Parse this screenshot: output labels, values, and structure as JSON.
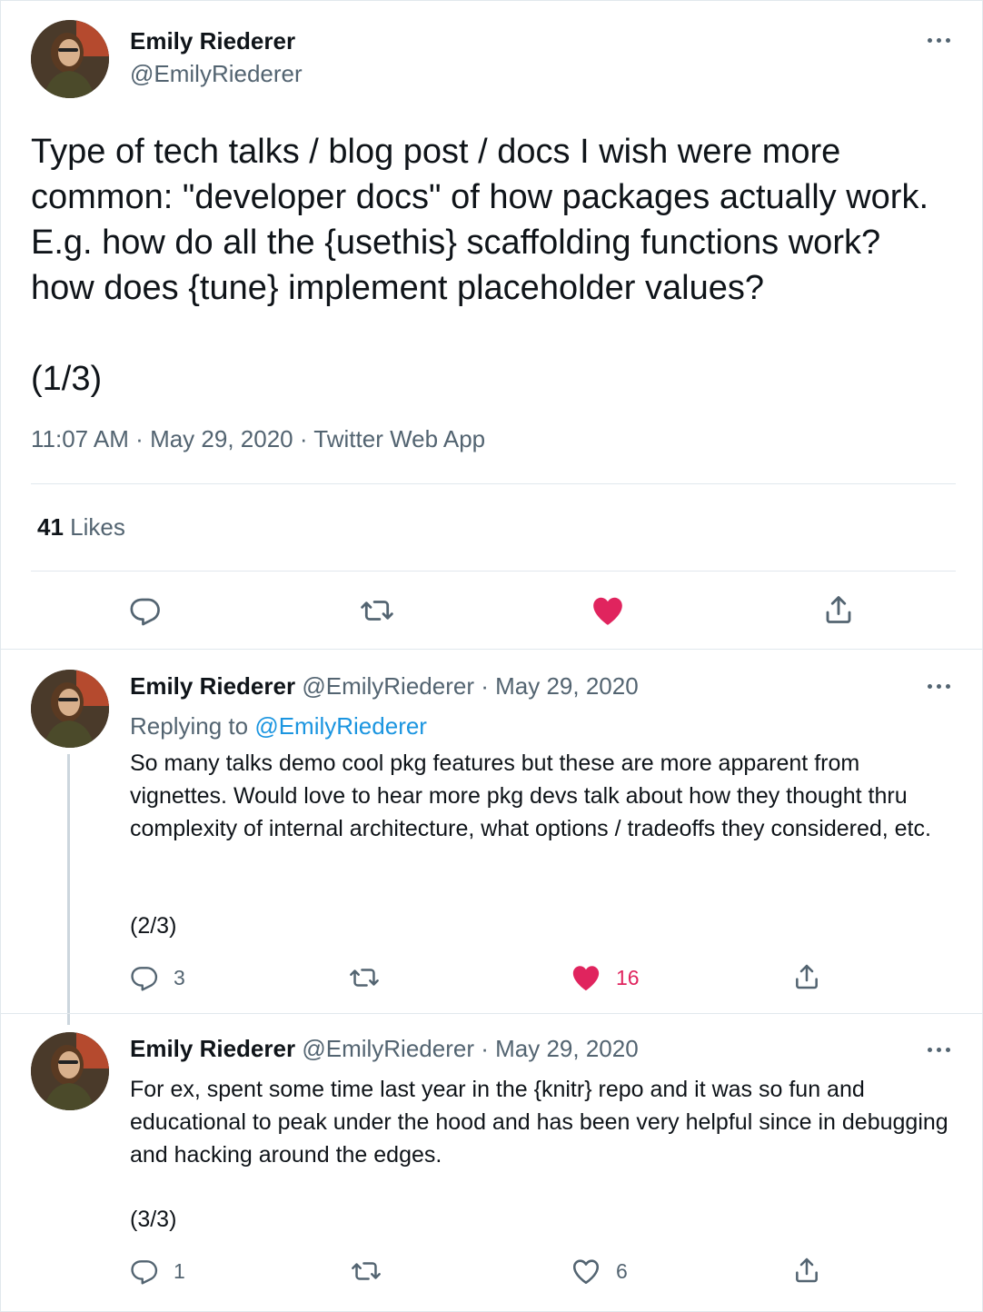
{
  "main_tweet": {
    "author_name": "Emily Riederer",
    "handle": "@EmilyRiederer",
    "text": "Type of tech talks / blog post / docs I wish were more common: \"developer docs\" of how packages actually work. E.g. how do all the {usethis} scaffolding functions work? how does {tune} implement placeholder values?",
    "part": "(1/3)",
    "time": "11:07 AM",
    "date": "May 29, 2020",
    "source": "Twitter Web App",
    "like_count": "41",
    "like_label": "Likes"
  },
  "replies": [
    {
      "author_name": "Emily Riederer",
      "handle": "@EmilyRiederer",
      "date": "May 29, 2020",
      "replying_label": "Replying to",
      "replying_handle": "@EmilyRiederer",
      "text": "So many talks demo cool pkg features but these are more apparent from vignettes. Would love to hear more pkg devs talk about how they thought thru complexity of internal architecture, what options / tradeoffs they considered, etc.",
      "part": "(2/3)",
      "reply_count": "3",
      "retweet_count": "",
      "like_count": "16",
      "liked": true
    },
    {
      "author_name": "Emily Riederer",
      "handle": "@EmilyRiederer",
      "date": "May 29, 2020",
      "text": "For ex, spent some time last year in the {knitr} repo and it was so fun and educational to peak under the hood and has been very helpful since in debugging and hacking around the edges.",
      "part": "(3/3)",
      "reply_count": "1",
      "retweet_count": "",
      "like_count": "6",
      "liked": false
    }
  ],
  "icons": {
    "reply": "reply-icon",
    "retweet": "retweet-icon",
    "like": "heart-icon",
    "share": "share-icon",
    "more": "more-icon"
  },
  "colors": {
    "text": "#0f1419",
    "secondary": "#536471",
    "link": "#1b95e0",
    "like": "#e0245e",
    "border": "#e1e8ed"
  }
}
